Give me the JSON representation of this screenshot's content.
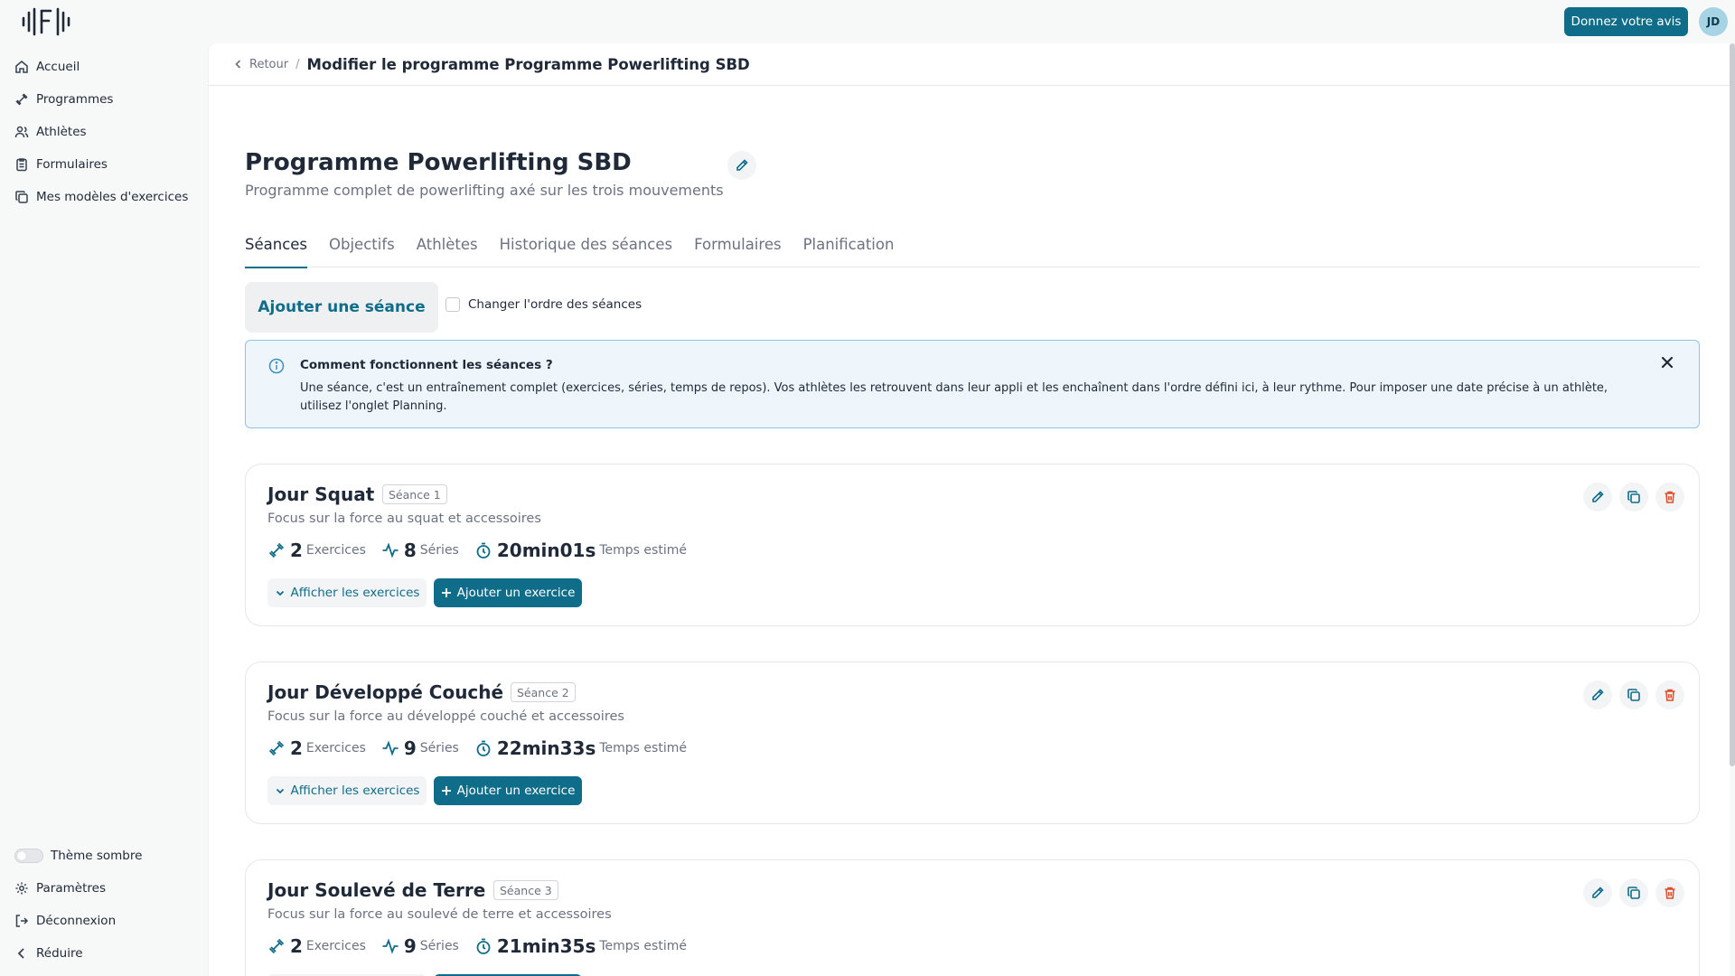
{
  "header": {
    "feedback_label": "Donnez votre avis",
    "avatar_initials": "JD"
  },
  "sidebar": {
    "items": [
      {
        "label": "Accueil",
        "icon": "home-icon"
      },
      {
        "label": "Programmes",
        "icon": "dumbbell-icon"
      },
      {
        "label": "Athlètes",
        "icon": "users-icon"
      },
      {
        "label": "Formulaires",
        "icon": "clipboard-icon"
      },
      {
        "label": "Mes modèles d'exercices",
        "icon": "copy-icon"
      }
    ],
    "bottom": {
      "theme_label": "Thème sombre",
      "settings_label": "Paramètres",
      "logout_label": "Déconnexion",
      "collapse_label": "Réduire"
    }
  },
  "breadcrumb": {
    "back_label": "Retour",
    "separator": "/",
    "title": "Modifier le programme Programme Powerlifting SBD"
  },
  "program": {
    "title": "Programme Powerlifting SBD",
    "subtitle": "Programme complet de powerlifting axé sur les trois mouvements"
  },
  "tabs": [
    {
      "label": "Séances",
      "active": true
    },
    {
      "label": "Objectifs",
      "active": false
    },
    {
      "label": "Athlètes",
      "active": false
    },
    {
      "label": "Historique des séances",
      "active": false
    },
    {
      "label": "Formulaires",
      "active": false
    },
    {
      "label": "Planification",
      "active": false
    }
  ],
  "toolbar": {
    "add_session_label": "Ajouter une séance",
    "reorder_label": "Changer l'ordre des séances",
    "reorder_checked": false
  },
  "info": {
    "title": "Comment fonctionnent les séances ?",
    "text": "Une séance, c'est un entraînement complet (exercices, séries, temps de repos). Vos athlètes les retrouvent dans leur appli et les enchaînent dans l'ordre défini ici, à leur rythme. Pour imposer une date précise à un athlète, utilisez l'onglet Planning."
  },
  "session_labels": {
    "exercises": "Exercices",
    "series": "Séries",
    "time": "Temps estimé",
    "show_exercises": "Afficher les exercices",
    "add_exercise": "Ajouter un exercice"
  },
  "sessions": [
    {
      "name": "Jour Squat",
      "badge": "Séance 1",
      "description": "Focus sur la force au squat et accessoires",
      "exercises": "2",
      "series": "8",
      "time": "20min01s"
    },
    {
      "name": "Jour Développé Couché",
      "badge": "Séance 2",
      "description": "Focus sur la force au développé couché et accessoires",
      "exercises": "2",
      "series": "9",
      "time": "22min33s"
    },
    {
      "name": "Jour Soulevé de Terre",
      "badge": "Séance 3",
      "description": "Focus sur la force au soulevé de terre et accessoires",
      "exercises": "2",
      "series": "9",
      "time": "21min35s"
    }
  ],
  "colors": {
    "accent": "#0f6d8a",
    "danger": "#dc4f2c",
    "info_bg": "#eef6fc",
    "info_border": "#8ec5e6"
  }
}
